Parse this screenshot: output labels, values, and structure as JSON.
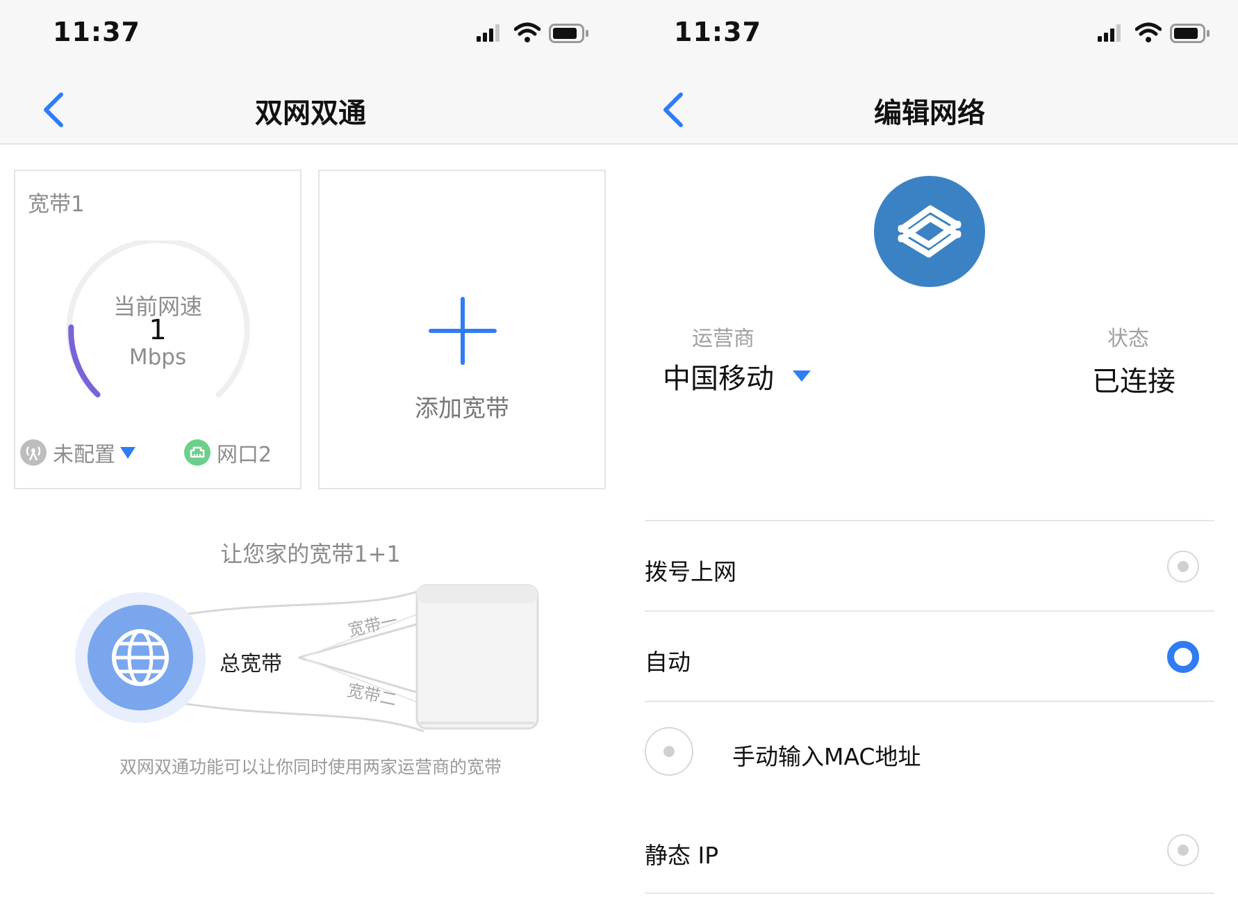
{
  "left": {
    "time": "11:37",
    "title": "双网双通",
    "card1": {
      "label": "宽带1",
      "speed_caption": "当前网速",
      "speed_value": "1",
      "speed_unit": "Mbps",
      "isp_value": "未配置",
      "port_value": "网口2"
    },
    "card2": {
      "label": "添加宽带"
    },
    "promo": {
      "headline": "让您家的宽带1+1",
      "total_label": "总宽带",
      "line1": "宽带一",
      "line2": "宽带二",
      "caption": "双网双通功能可以让你同时使用两家运营商的宽带"
    }
  },
  "right": {
    "time": "11:37",
    "title": "编辑网络",
    "isp_label": "运营商",
    "isp_value": "中国移动",
    "status_label": "状态",
    "status_value": "已连接",
    "options": [
      {
        "label": "拨号上网",
        "selected": false
      },
      {
        "label": "自动",
        "selected": true
      },
      {
        "label": "手动输入MAC地址",
        "selected": false
      },
      {
        "label": "静态 IP",
        "selected": false
      }
    ]
  },
  "colors": {
    "accent": "#2f7cf6",
    "isp_logo": "#3b82c4",
    "gauge_arc": "#7a63d6",
    "port_icon": "#6ccf8a"
  },
  "icons": {
    "back": "chevron-left-icon",
    "signal": "cellular-signal-icon",
    "wifi": "wifi-icon",
    "battery": "battery-icon",
    "add": "plus-icon",
    "globe": "globe-icon",
    "router": "router-box-icon"
  }
}
